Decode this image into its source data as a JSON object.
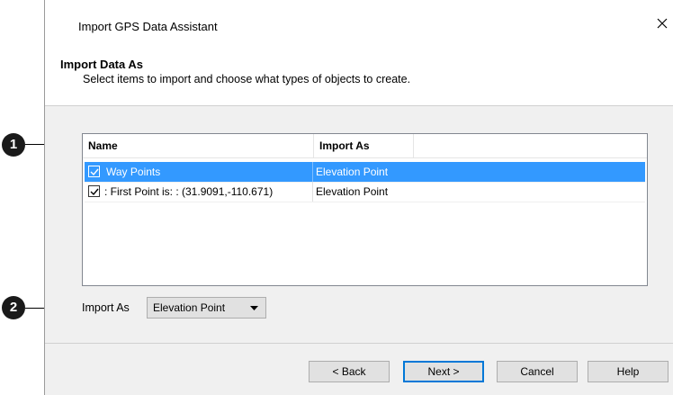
{
  "dialog": {
    "title": "Import GPS Data Assistant",
    "step_title": "Import Data As",
    "step_description": "Select items to import and choose what types of objects to create."
  },
  "list": {
    "columns": [
      "Name",
      "Import As"
    ],
    "rows": [
      {
        "checked": true,
        "selected": true,
        "name": "Way Points",
        "import_as": "Elevation Point"
      },
      {
        "checked": true,
        "selected": false,
        "name": ": First Point is: : (31.9091,-110.671)",
        "import_as": "Elevation Point"
      }
    ]
  },
  "import_as": {
    "label": "Import As",
    "selected_value": "Elevation Point"
  },
  "buttons": {
    "back": "< Back",
    "next": "Next >",
    "cancel": "Cancel",
    "help": "Help"
  },
  "callouts": [
    "1",
    "2"
  ],
  "colors": {
    "selection": "#3399ff",
    "default_button_border": "#0078d7",
    "dialog_background": "#f0f0f0"
  },
  "icons": [
    "close-icon",
    "checkbox-checked-icon",
    "dropdown-arrow-icon"
  ]
}
